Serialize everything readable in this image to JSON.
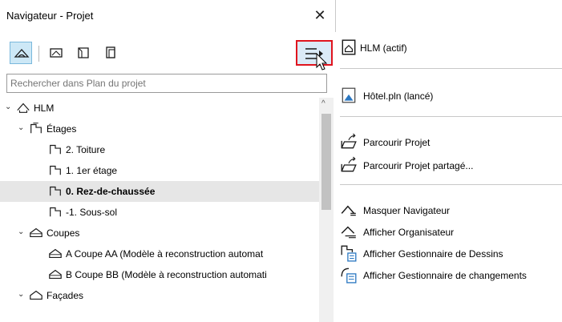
{
  "navigator": {
    "title": "Navigateur - Projet",
    "close_label": "✕",
    "search_placeholder": "Rechercher dans Plan du projet",
    "tree": [
      {
        "label": "HLM",
        "icon": "project-house-icon",
        "expanded": true
      },
      {
        "label": "Étages",
        "icon": "stories-icon",
        "expanded": true
      },
      {
        "label": "2. Toiture",
        "icon": "story-icon"
      },
      {
        "label": "1. 1er étage",
        "icon": "story-icon"
      },
      {
        "label": "0. Rez-de-chaussée",
        "icon": "story-icon",
        "selected": true
      },
      {
        "label": "-1. Sous-sol",
        "icon": "story-icon"
      },
      {
        "label": "Coupes",
        "icon": "sections-icon",
        "expanded": true
      },
      {
        "label": "A Coupe AA (Modèle à reconstruction automat",
        "icon": "section-icon"
      },
      {
        "label": "B Coupe BB (Modèle à reconstruction automati",
        "icon": "section-icon"
      },
      {
        "label": "Façades",
        "icon": "elevations-icon",
        "expanded": true
      }
    ]
  },
  "menu": {
    "items": [
      {
        "label": "HLM (actif)",
        "icon": "project-active-icon"
      },
      {
        "label": "Hôtel.pln (lancé)",
        "icon": "project-file-icon"
      },
      {
        "label": "Parcourir Projet",
        "icon": "browse-project-icon"
      },
      {
        "label": "Parcourir Projet partagé...",
        "icon": "browse-shared-project-icon"
      },
      {
        "label": "Masquer Navigateur",
        "icon": "hide-navigator-icon"
      },
      {
        "label": "Afficher Organisateur",
        "icon": "show-organizer-icon"
      },
      {
        "label": "Afficher Gestionnaire de Dessins",
        "icon": "drawing-manager-icon"
      },
      {
        "label": "Afficher Gestionnaire de changements",
        "icon": "change-manager-icon"
      }
    ]
  },
  "colors": {
    "highlight_border": "#e0141e",
    "active_tab": "#cde8f6",
    "selected_row": "#e6e6e6"
  }
}
